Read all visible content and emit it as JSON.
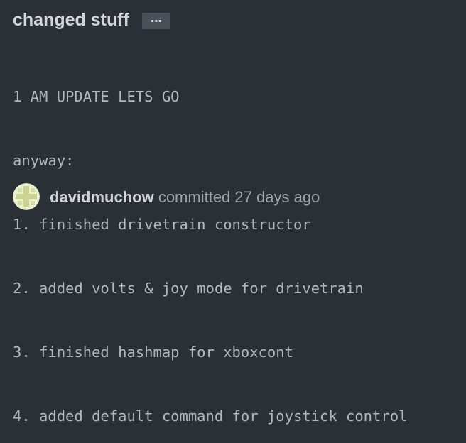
{
  "commit": {
    "title": "changed stuff",
    "more_button_label": "…",
    "body_lines": [
      "1 AM UPDATE LETS GO",
      "anyway:",
      "1. finished drivetrain constructor",
      "2. added volts & joy mode for drivetrain",
      "3. finished hashmap for xboxcont",
      "4. added default command for joystick control"
    ],
    "author": "davidmuchow",
    "committed_text": "committed",
    "time_ago": "27 days ago"
  },
  "colors": {
    "background": "#2b3036",
    "avatar_bg": "#e8f0d0",
    "avatar_fg": "#c9d28f"
  },
  "icons": {
    "avatar": "identicon-avatar",
    "more": "ellipsis-icon"
  }
}
